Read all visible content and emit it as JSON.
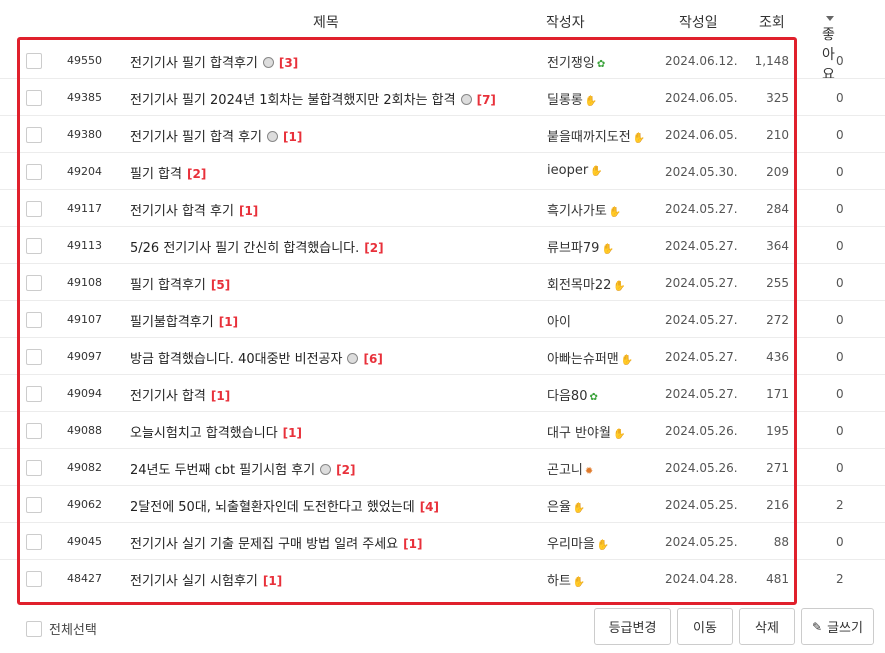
{
  "header": {
    "title": "제목",
    "author": "작성자",
    "date": "작성일",
    "views": "조회",
    "likes": "좋아요"
  },
  "rows": [
    {
      "num": "49550",
      "title": "전기기사 필기 합격후기",
      "face": true,
      "comments": "[3]",
      "author": "전기쟁잉",
      "level": "sprout-icon",
      "date": "2024.06.12.",
      "views": "1,148",
      "likes": "0"
    },
    {
      "num": "49385",
      "title": "전기기사 필기 2024년 1회차는 불합격했지만 2회차는 합격",
      "face": true,
      "comments": "[7]",
      "author": "딜롱롱",
      "level": "hand-icon",
      "date": "2024.06.05.",
      "views": "325",
      "likes": "0"
    },
    {
      "num": "49380",
      "title": "전기기사 필기 합격 후기",
      "face": true,
      "comments": "[1]",
      "author": "붙을때까지도전",
      "level": "hand-icon",
      "date": "2024.06.05.",
      "views": "210",
      "likes": "0"
    },
    {
      "num": "49204",
      "title": "필기 합격",
      "face": false,
      "comments": "[2]",
      "author": "ieoper",
      "level": "hand-icon",
      "date": "2024.05.30.",
      "views": "209",
      "likes": "0"
    },
    {
      "num": "49117",
      "title": "전기기사 합격 후기",
      "face": false,
      "comments": "[1]",
      "author": "흑기사가토",
      "level": "hand-icon",
      "date": "2024.05.27.",
      "views": "284",
      "likes": "0"
    },
    {
      "num": "49113",
      "title": "5/26 전기기사 필기 간신히 합격했습니다.",
      "face": false,
      "comments": "[2]",
      "author": "류브파79",
      "level": "hand-icon",
      "date": "2024.05.27.",
      "views": "364",
      "likes": "0"
    },
    {
      "num": "49108",
      "title": "필기 합격후기",
      "face": false,
      "comments": "[5]",
      "author": "회전목마22",
      "level": "blue-hand-icon",
      "date": "2024.05.27.",
      "views": "255",
      "likes": "0"
    },
    {
      "num": "49107",
      "title": "필기불합격후기",
      "face": false,
      "comments": "[1]",
      "author": "아이",
      "level": "",
      "date": "2024.05.27.",
      "views": "272",
      "likes": "0"
    },
    {
      "num": "49097",
      "title": "방금 합격했습니다. 40대중반 비전공자",
      "face": true,
      "comments": "[6]",
      "author": "아빠는슈퍼맨",
      "level": "hand-icon",
      "date": "2024.05.27.",
      "views": "436",
      "likes": "0"
    },
    {
      "num": "49094",
      "title": "전기기사 합격",
      "face": false,
      "comments": "[1]",
      "author": "다음80",
      "level": "sprout-icon",
      "date": "2024.05.27.",
      "views": "171",
      "likes": "0"
    },
    {
      "num": "49088",
      "title": "오늘시험치고 합격했습니다",
      "face": false,
      "comments": "[1]",
      "author": "대구 반야월",
      "level": "hand-icon",
      "date": "2024.05.26.",
      "views": "195",
      "likes": "0"
    },
    {
      "num": "49082",
      "title": "24년도 두번째 cbt 필기시험 후기",
      "face": true,
      "comments": "[2]",
      "author": "곤고니",
      "level": "sun-icon",
      "date": "2024.05.26.",
      "views": "271",
      "likes": "0"
    },
    {
      "num": "49062",
      "title": "2달전에 50대, 뇌출혈환자인데 도전한다고 했었는데",
      "face": false,
      "comments": "[4]",
      "author": "은율",
      "level": "hand-icon",
      "date": "2024.05.25.",
      "views": "216",
      "likes": "2"
    },
    {
      "num": "49045",
      "title": "전기기사 실기 기출 문제집 구매 방법 일려 주세요",
      "face": false,
      "comments": "[1]",
      "author": "우리마을",
      "level": "hand-icon",
      "date": "2024.05.25.",
      "views": "88",
      "likes": "0"
    },
    {
      "num": "48427",
      "title": "전기기사 실기 시험후기",
      "face": false,
      "comments": "[1]",
      "author": "하트",
      "level": "hand-icon",
      "date": "2024.04.28.",
      "views": "481",
      "likes": "2"
    }
  ],
  "footer": {
    "select_all": "전체선택",
    "grade_change": "등급변경",
    "move": "이동",
    "delete": "삭제",
    "write": "글쓰기"
  },
  "colors": {
    "highlight": "#e0202c",
    "comment_count": "#e8303a"
  }
}
